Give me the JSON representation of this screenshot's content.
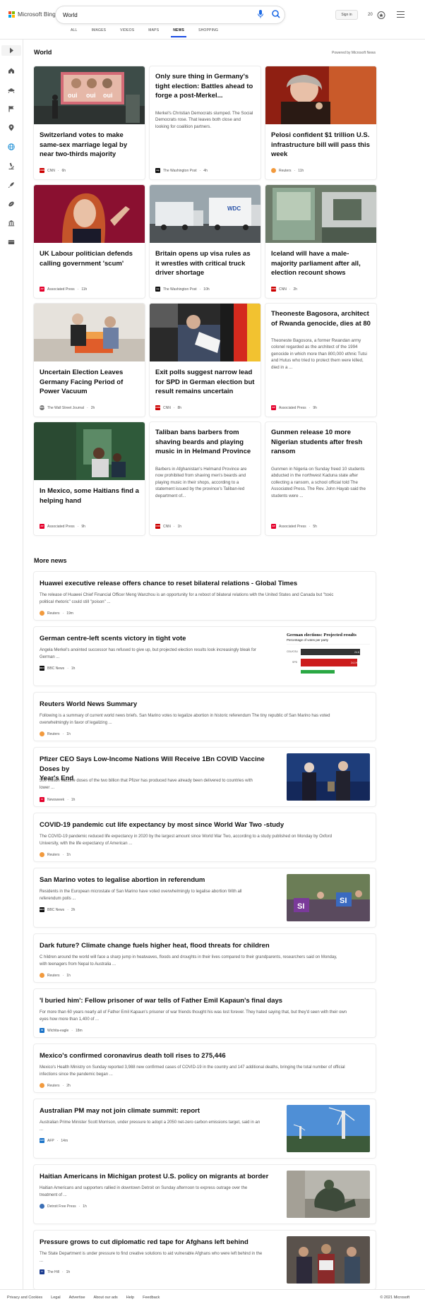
{
  "brand": {
    "logo_text": "Microsoft Bing",
    "colors": [
      "#f25022",
      "#7fba00",
      "#00a4ef",
      "#ffb900"
    ]
  },
  "search": {
    "value": "World"
  },
  "header": {
    "sign_in": "Sign in",
    "rewards_count": "20"
  },
  "tabs": [
    {
      "label": "ALL",
      "active": false
    },
    {
      "label": "IMAGES",
      "active": false
    },
    {
      "label": "VIDEOS",
      "active": false
    },
    {
      "label": "MAPS",
      "active": false
    },
    {
      "label": "NEWS",
      "active": true
    },
    {
      "label": "SHOPPING",
      "active": false
    }
  ],
  "sidebar": {
    "icons": [
      "expand-icon",
      "home-icon",
      "ufo-icon",
      "flag-icon",
      "location-icon",
      "globe-icon",
      "microscope-icon",
      "rocket-icon",
      "football-icon",
      "bank-icon",
      "film-icon"
    ]
  },
  "world": {
    "title": "World",
    "powered": "Powered by Microsoft News",
    "cards": [
      {
        "title": "Switzerland votes to make same-sex marriage legal by near two-thirds majority",
        "provider": "CNN",
        "time": "6h",
        "logo": "CNN",
        "logo_color": "#cc0000"
      },
      {
        "title": "Only sure thing in Germany's tight election: Battles ahead to forge a post-Merkel...",
        "desc": "Merkel's Christian Democrats slumped. The Social Democrats rose. That leaves both close and looking for coalition partners.",
        "provider": "The Washington Post",
        "time": "4h",
        "logo": "wp",
        "logo_color": "#111111"
      },
      {
        "title": "Pelosi confident $1 trillion U.S. infrastructure bill will pass this week",
        "provider": "Reuters",
        "time": "11h",
        "logo": "R",
        "logo_color": "#f29a3d"
      },
      {
        "title": "UK Labour politician defends calling government 'scum'",
        "provider": "Associated Press",
        "time": "11h",
        "logo": "AP",
        "logo_color": "#e4002b"
      },
      {
        "title": "Britain opens up visa rules as it wrestles with critical truck driver shortage",
        "provider": "The Washington Post",
        "time": "10h",
        "logo": "wp",
        "logo_color": "#111111"
      },
      {
        "title": "Iceland will have a male-majority parliament after all, election recount shows",
        "provider": "CNN",
        "time": "2h",
        "logo": "CNN",
        "logo_color": "#cc0000"
      },
      {
        "title": "Uncertain Election Leaves Germany Facing Period of Power Vacuum",
        "provider": "The Wall Street Journal",
        "time": "2h",
        "logo": "WSJ",
        "logo_color": "#777777"
      },
      {
        "title": "Exit polls suggest narrow lead for SPD in German election but result remains uncertain",
        "provider": "CNN",
        "time": "8h",
        "logo": "CNN",
        "logo_color": "#cc0000"
      },
      {
        "title": "Theoneste Bagosora, architect of Rwanda genocide, dies at 80",
        "desc": "Theoneste Bagosora, a former Rwandan army colonel regarded as the architect of the 1994 genocide in which more than 800,000 ethnic Tutsi and Hutus who tried to protect them were killed, died in a ...",
        "provider": "Associated Press",
        "time": "9h",
        "logo": "AP",
        "logo_color": "#e4002b"
      },
      {
        "title": "In Mexico, some Haitians find a helping hand",
        "provider": "Associated Press",
        "time": "9h",
        "logo": "AP",
        "logo_color": "#e4002b"
      },
      {
        "title": "Taliban bans barbers from shaving beards and playing music in in Helmand Province",
        "desc": "Barbers in Afghanistan's Helmand Province are now prohibited from shaving men's beards and playing music in their shops, according to a statement issued by the province's Taliban-led department of...",
        "provider": "CNN",
        "time": "1h",
        "logo": "CNN",
        "logo_color": "#cc0000"
      },
      {
        "title": "Gunmen release 10 more Nigerian students after fresh ransom",
        "desc": "Gunmen in Nigeria on Sunday freed 10 students abducted in the northwest Kaduna state after collecting a ransom, a school official told The Associated Press. The Rev. John Hayab said the students were ...",
        "provider": "Associated Press",
        "time": "5h",
        "logo": "AP",
        "logo_color": "#e4002b"
      }
    ]
  },
  "more_news": {
    "title": "More news",
    "items": [
      {
        "title": "Huawei executive release offers chance to reset bilateral relations - Global Times",
        "desc1": "The release of Huawei Chief Financial Officer Meng Wanzhou is an opportunity for a reboot of bilateral relations with the United States and Canada but \"toxic",
        "desc2": "political rhetoric\" could still \"poison\" ...",
        "provider": "Reuters",
        "time": "19m",
        "logo": "R",
        "logo_color": "#f29a3d"
      },
      {
        "title": "German centre-left scents victory in tight vote",
        "desc1": "Angela Merkel's anointed successor has refused to give up, but projected election results look increasingly bleak for",
        "desc2": "German ...",
        "provider": "BBC News",
        "time": "1h",
        "logo": "BBC",
        "logo_color": "#111111"
      },
      {
        "title": "Reuters World News Summary",
        "desc1": "Following is a summary of current world news briefs. San Marino votes to legalize abortion in historic referendum The tiny republic of San Marino has voted",
        "desc2": "overwhelmingly in favor of legalizing ...",
        "provider": "Reuters",
        "time": "1h",
        "logo": "R",
        "logo_color": "#f29a3d"
      },
      {
        "title": "Pfizer CEO Says Low-Income Nations Will Receive 1Bn COVID Vaccine Doses by",
        "title2": "Year's End",
        "desc1": "500 million vaccine doses of the two billion that Pfizer has produced have already been delivered to countries with",
        "desc2": "lower ...",
        "provider": "Newsweek",
        "time": "1h",
        "logo": "N",
        "logo_color": "#e4002b"
      },
      {
        "title": "COVID-19 pandemic cut life expectancy by most since World War Two -study",
        "desc1": "The COVID-19 pandemic reduced life expectancy in 2020 by the largest amount since World War Two, according to a study published on Monday by Oxford",
        "desc2": "University, with the life expectancy of American ...",
        "provider": "Reuters",
        "time": "1h",
        "logo": "R",
        "logo_color": "#f29a3d"
      },
      {
        "title": "San Marino votes to legalise abortion in referendum",
        "desc1": "Residents in the European microstate of San Marino have voted overwhelmingly to legalise abortion With all",
        "desc2": "referendum polls ...",
        "provider": "BBC News",
        "time": "2h",
        "logo": "BBC",
        "logo_color": "#111111"
      },
      {
        "title": "Dark future? Climate change fuels higher heat, flood threats for children",
        "desc1": "C hildren around the world will face a sharp jump in heatwaves, floods and droughts in their lives compared to their grandparents, researchers said on Monday,",
        "desc2": "with teenagers from Nepal to Australia ...",
        "provider": "Reuters",
        "time": "1h",
        "logo": "R",
        "logo_color": "#f29a3d"
      },
      {
        "title": "'I buried him': Fellow prisoner of war tells of Father Emil Kapaun's final days",
        "desc1": "For more than 60 years nearly all of Father Emil Kapaun's prisoner of war friends thought his was lost forever. They hated saying that, but they'd seen with their own",
        "desc2": "eyes how more than 1,400 of ...",
        "provider": "Wichita-eagle",
        "time": "18m",
        "logo": "W",
        "logo_color": "#1a73c8"
      },
      {
        "title": "Mexico's confirmed coronavirus death toll rises to 275,446",
        "desc1": "Mexico's Health Ministry on Sunday reported 3,988 new confirmed cases of COVID-19 in the country and 147 additional deaths, bringing the total number of official",
        "desc2": "infections since the pandemic began ...",
        "provider": "Reuters",
        "time": "2h",
        "logo": "R",
        "logo_color": "#f29a3d"
      },
      {
        "title": "Australian PM may not join climate summit: report",
        "desc1": "Australian Prime Minister Scott Morrison, under pressure to adopt a 2050 net-zero carbon emissions target, said in an",
        "desc2": "...",
        "provider": "AFP",
        "time": "14m",
        "logo": "AFP",
        "logo_color": "#1a73c8"
      },
      {
        "title": "Haitian Americans in Michigan protest U.S. policy on migrants at border",
        "desc1": "Haitian Americans and supporters rallied in downtown Detroit on Sunday afternoon to express outrage over the",
        "desc2": "treatment of ...",
        "provider": "Detroit Free Press",
        "time": "1h",
        "logo": "D",
        "logo_color": "#3b6fb6"
      },
      {
        "title": "Pressure grows to cut diplomatic red tape for Afghans left behind",
        "desc1": "The State Department is under pressure to find creative solutions to aid vulnerable Afghans who were left behind in the",
        "desc2": "...",
        "provider": "The Hill",
        "time": "1h",
        "logo": "H",
        "logo_color": "#1a3a8f"
      }
    ]
  },
  "german_chart": {
    "title": "German elections: Projected results",
    "subtitle": "Percentage of votes per party",
    "rows": [
      {
        "party": "CDU/CSU",
        "value": "24.6",
        "color": "#333333"
      },
      {
        "party": "SPD",
        "value": "24.1%",
        "color": "#cc1d1d"
      },
      {
        "party": "",
        "value": "",
        "color": "#2aa844"
      }
    ]
  },
  "footer": {
    "links": [
      "Privacy and Cookies",
      "Legal",
      "Advertise",
      "About our ads",
      "Help",
      "Feedback"
    ],
    "copyright": "© 2021 Microsoft"
  }
}
